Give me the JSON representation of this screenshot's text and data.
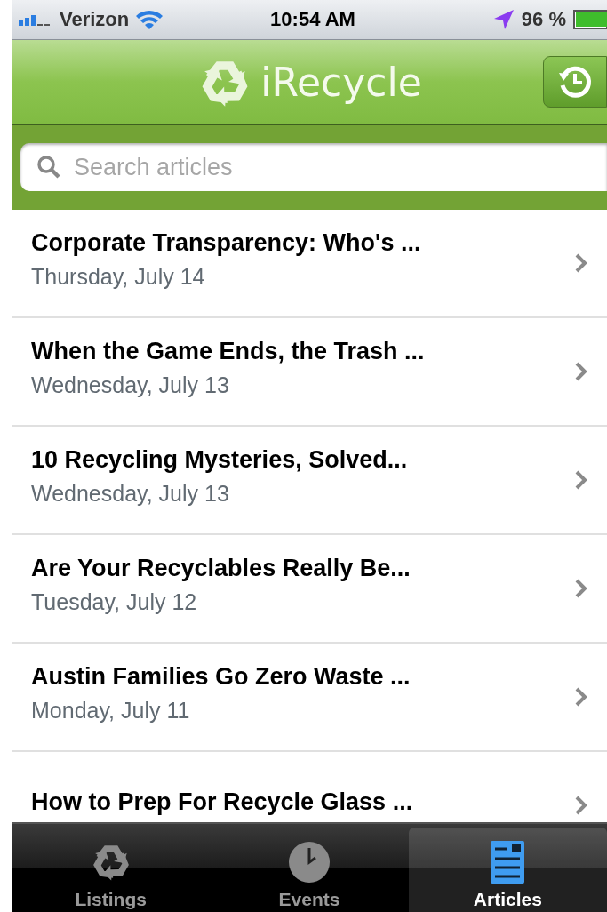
{
  "status_bar": {
    "carrier": "Verizon",
    "time": "10:54 AM",
    "battery": "96 %"
  },
  "header": {
    "title": "iRecycle"
  },
  "search": {
    "placeholder": "Search articles"
  },
  "articles": [
    {
      "title": "Corporate Transparency: Who's ...",
      "date": "Thursday, July 14"
    },
    {
      "title": "When the Game Ends, the Trash ...",
      "date": "Wednesday, July 13"
    },
    {
      "title": "10 Recycling Mysteries, Solved...",
      "date": "Wednesday, July 13"
    },
    {
      "title": "Are Your Recyclables Really Be...",
      "date": "Tuesday, July 12"
    },
    {
      "title": "Austin Families Go Zero Waste ...",
      "date": "Monday, July 11"
    },
    {
      "title": "How to Prep For Recycle Glass ..."
    }
  ],
  "tabs": [
    {
      "label": "Listings",
      "kind": "recycle",
      "selected": false
    },
    {
      "label": "Events",
      "kind": "clock",
      "selected": false
    },
    {
      "label": "Articles",
      "kind": "article",
      "selected": true
    }
  ]
}
